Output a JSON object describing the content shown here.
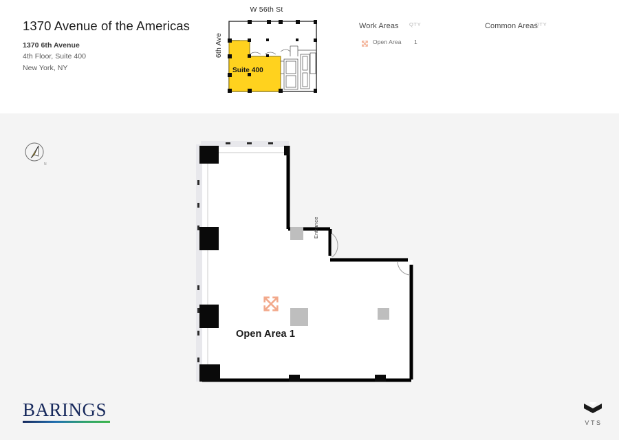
{
  "header": {
    "building_title": "1370 Avenue of the Americas",
    "street_address": "1370 6th Avenue",
    "floor_suite": "4th Floor, Suite 400",
    "city_state": "New York, NY"
  },
  "key_plan": {
    "street_label_top": "W 56th St",
    "street_label_left": "6th Ave",
    "suite_label": "Suite 400",
    "highlight_color": "#FFD21E"
  },
  "legend": {
    "columns": [
      {
        "title": "Work Areas",
        "qty_header": "QTY",
        "rows": [
          {
            "icon": "expand-arrows-icon",
            "label": "Open Area",
            "qty": "1"
          }
        ]
      },
      {
        "title": "Common Areas",
        "qty_header": "QTY",
        "rows": []
      }
    ],
    "icon_color": "#F2A98B"
  },
  "plan": {
    "compass_label": "N",
    "entrance_label": "Entrance",
    "open_area_label": "Open Area 1",
    "area_icon": "expand-arrows-icon",
    "area_icon_color": "#F2A98B",
    "column_color": "#BEBEBE",
    "wall_color": "#000000",
    "canvas_color": "#F4F4F4"
  },
  "footer": {
    "brand_logo": "BARINGS",
    "vendor_logo": "VTS",
    "vendor_mark": "chevron-mark-icon"
  }
}
